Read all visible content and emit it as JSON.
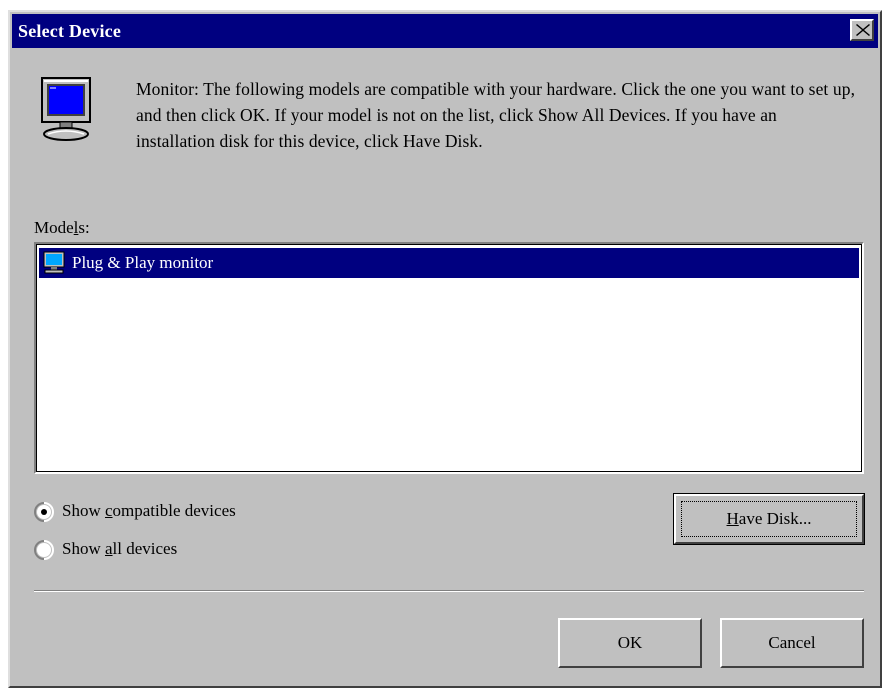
{
  "window": {
    "title": "Select Device"
  },
  "description": {
    "text": "Monitor: The following models are compatible with your hardware. Click the one you want to set up, and then click OK. If your model is not on the list, click Show All Devices. If you have an installation disk for this device, click Have Disk."
  },
  "models": {
    "label_pre": "Mode",
    "label_accel": "l",
    "label_post": "s:",
    "items": [
      {
        "label": "Plug & Play monitor",
        "selected": true,
        "icon": "monitor-icon"
      }
    ]
  },
  "options": {
    "compatible": {
      "pre": "Show ",
      "accel": "c",
      "post": "ompatible devices",
      "checked": true
    },
    "all": {
      "pre": "Show ",
      "accel": "a",
      "post": "ll devices",
      "checked": false
    }
  },
  "buttons": {
    "have_disk": {
      "accel": "H",
      "post": "ave Disk..."
    },
    "ok": "OK",
    "cancel": "Cancel"
  },
  "colors": {
    "face": "#c0c0c0",
    "titlebar": "#000080",
    "selection": "#000080"
  }
}
